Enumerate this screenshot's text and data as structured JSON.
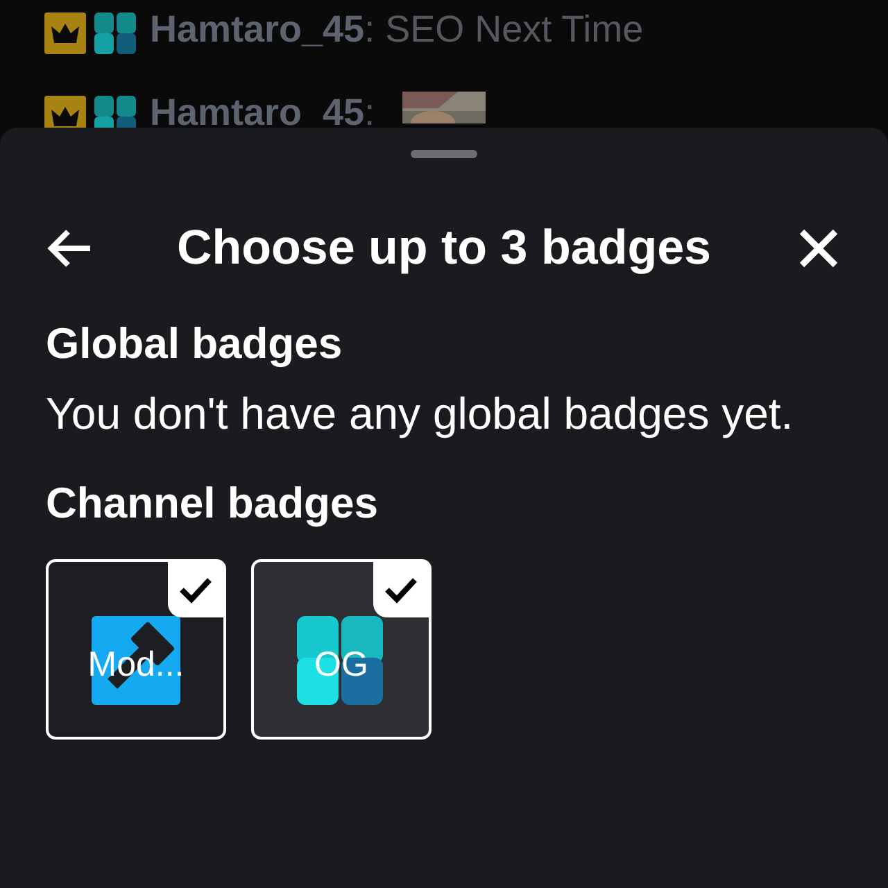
{
  "chat": [
    {
      "name": "Hamtaro_45",
      "message": ": SEO Next Time",
      "kind": "text"
    },
    {
      "name": "Hamtaro_45",
      "message": ":",
      "kind": "picture"
    }
  ],
  "sheet": {
    "title": "Choose up to 3 badges",
    "sections": [
      {
        "heading": "Global badges",
        "empty_text": "You don't have any global badges yet."
      },
      {
        "heading": "Channel badges",
        "badges": [
          {
            "label": "Mod...",
            "kind": "moderator",
            "checked": true,
            "selected": false
          },
          {
            "label": "OG",
            "kind": "og",
            "checked": true,
            "selected": true
          }
        ]
      }
    ]
  }
}
